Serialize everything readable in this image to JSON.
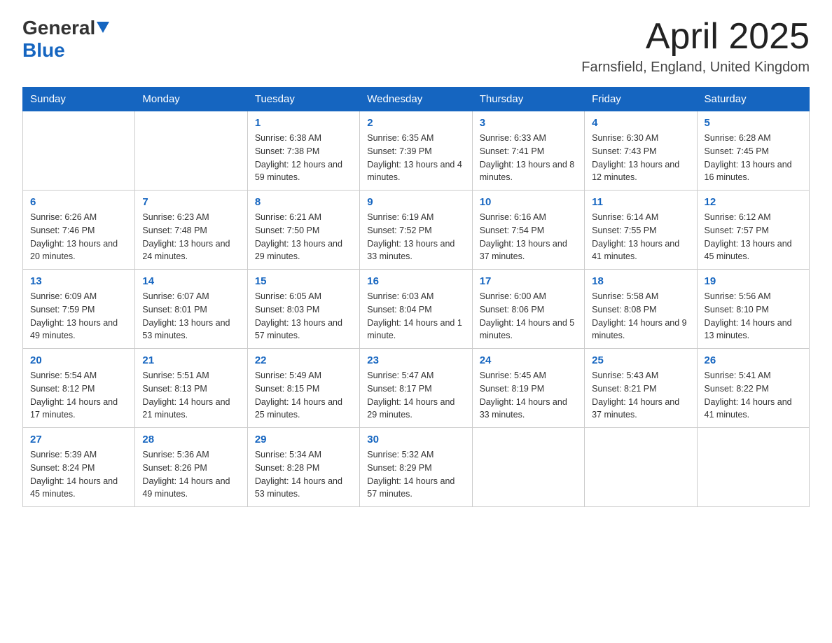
{
  "logo": {
    "general": "General",
    "blue": "Blue",
    "arrow": "▼"
  },
  "header": {
    "title": "April 2025",
    "location": "Farnsfield, England, United Kingdom"
  },
  "columns": [
    "Sunday",
    "Monday",
    "Tuesday",
    "Wednesday",
    "Thursday",
    "Friday",
    "Saturday"
  ],
  "weeks": [
    [
      {
        "day": "",
        "sunrise": "",
        "sunset": "",
        "daylight": ""
      },
      {
        "day": "",
        "sunrise": "",
        "sunset": "",
        "daylight": ""
      },
      {
        "day": "1",
        "sunrise": "Sunrise: 6:38 AM",
        "sunset": "Sunset: 7:38 PM",
        "daylight": "Daylight: 12 hours and 59 minutes."
      },
      {
        "day": "2",
        "sunrise": "Sunrise: 6:35 AM",
        "sunset": "Sunset: 7:39 PM",
        "daylight": "Daylight: 13 hours and 4 minutes."
      },
      {
        "day": "3",
        "sunrise": "Sunrise: 6:33 AM",
        "sunset": "Sunset: 7:41 PM",
        "daylight": "Daylight: 13 hours and 8 minutes."
      },
      {
        "day": "4",
        "sunrise": "Sunrise: 6:30 AM",
        "sunset": "Sunset: 7:43 PM",
        "daylight": "Daylight: 13 hours and 12 minutes."
      },
      {
        "day": "5",
        "sunrise": "Sunrise: 6:28 AM",
        "sunset": "Sunset: 7:45 PM",
        "daylight": "Daylight: 13 hours and 16 minutes."
      }
    ],
    [
      {
        "day": "6",
        "sunrise": "Sunrise: 6:26 AM",
        "sunset": "Sunset: 7:46 PM",
        "daylight": "Daylight: 13 hours and 20 minutes."
      },
      {
        "day": "7",
        "sunrise": "Sunrise: 6:23 AM",
        "sunset": "Sunset: 7:48 PM",
        "daylight": "Daylight: 13 hours and 24 minutes."
      },
      {
        "day": "8",
        "sunrise": "Sunrise: 6:21 AM",
        "sunset": "Sunset: 7:50 PM",
        "daylight": "Daylight: 13 hours and 29 minutes."
      },
      {
        "day": "9",
        "sunrise": "Sunrise: 6:19 AM",
        "sunset": "Sunset: 7:52 PM",
        "daylight": "Daylight: 13 hours and 33 minutes."
      },
      {
        "day": "10",
        "sunrise": "Sunrise: 6:16 AM",
        "sunset": "Sunset: 7:54 PM",
        "daylight": "Daylight: 13 hours and 37 minutes."
      },
      {
        "day": "11",
        "sunrise": "Sunrise: 6:14 AM",
        "sunset": "Sunset: 7:55 PM",
        "daylight": "Daylight: 13 hours and 41 minutes."
      },
      {
        "day": "12",
        "sunrise": "Sunrise: 6:12 AM",
        "sunset": "Sunset: 7:57 PM",
        "daylight": "Daylight: 13 hours and 45 minutes."
      }
    ],
    [
      {
        "day": "13",
        "sunrise": "Sunrise: 6:09 AM",
        "sunset": "Sunset: 7:59 PM",
        "daylight": "Daylight: 13 hours and 49 minutes."
      },
      {
        "day": "14",
        "sunrise": "Sunrise: 6:07 AM",
        "sunset": "Sunset: 8:01 PM",
        "daylight": "Daylight: 13 hours and 53 minutes."
      },
      {
        "day": "15",
        "sunrise": "Sunrise: 6:05 AM",
        "sunset": "Sunset: 8:03 PM",
        "daylight": "Daylight: 13 hours and 57 minutes."
      },
      {
        "day": "16",
        "sunrise": "Sunrise: 6:03 AM",
        "sunset": "Sunset: 8:04 PM",
        "daylight": "Daylight: 14 hours and 1 minute."
      },
      {
        "day": "17",
        "sunrise": "Sunrise: 6:00 AM",
        "sunset": "Sunset: 8:06 PM",
        "daylight": "Daylight: 14 hours and 5 minutes."
      },
      {
        "day": "18",
        "sunrise": "Sunrise: 5:58 AM",
        "sunset": "Sunset: 8:08 PM",
        "daylight": "Daylight: 14 hours and 9 minutes."
      },
      {
        "day": "19",
        "sunrise": "Sunrise: 5:56 AM",
        "sunset": "Sunset: 8:10 PM",
        "daylight": "Daylight: 14 hours and 13 minutes."
      }
    ],
    [
      {
        "day": "20",
        "sunrise": "Sunrise: 5:54 AM",
        "sunset": "Sunset: 8:12 PM",
        "daylight": "Daylight: 14 hours and 17 minutes."
      },
      {
        "day": "21",
        "sunrise": "Sunrise: 5:51 AM",
        "sunset": "Sunset: 8:13 PM",
        "daylight": "Daylight: 14 hours and 21 minutes."
      },
      {
        "day": "22",
        "sunrise": "Sunrise: 5:49 AM",
        "sunset": "Sunset: 8:15 PM",
        "daylight": "Daylight: 14 hours and 25 minutes."
      },
      {
        "day": "23",
        "sunrise": "Sunrise: 5:47 AM",
        "sunset": "Sunset: 8:17 PM",
        "daylight": "Daylight: 14 hours and 29 minutes."
      },
      {
        "day": "24",
        "sunrise": "Sunrise: 5:45 AM",
        "sunset": "Sunset: 8:19 PM",
        "daylight": "Daylight: 14 hours and 33 minutes."
      },
      {
        "day": "25",
        "sunrise": "Sunrise: 5:43 AM",
        "sunset": "Sunset: 8:21 PM",
        "daylight": "Daylight: 14 hours and 37 minutes."
      },
      {
        "day": "26",
        "sunrise": "Sunrise: 5:41 AM",
        "sunset": "Sunset: 8:22 PM",
        "daylight": "Daylight: 14 hours and 41 minutes."
      }
    ],
    [
      {
        "day": "27",
        "sunrise": "Sunrise: 5:39 AM",
        "sunset": "Sunset: 8:24 PM",
        "daylight": "Daylight: 14 hours and 45 minutes."
      },
      {
        "day": "28",
        "sunrise": "Sunrise: 5:36 AM",
        "sunset": "Sunset: 8:26 PM",
        "daylight": "Daylight: 14 hours and 49 minutes."
      },
      {
        "day": "29",
        "sunrise": "Sunrise: 5:34 AM",
        "sunset": "Sunset: 8:28 PM",
        "daylight": "Daylight: 14 hours and 53 minutes."
      },
      {
        "day": "30",
        "sunrise": "Sunrise: 5:32 AM",
        "sunset": "Sunset: 8:29 PM",
        "daylight": "Daylight: 14 hours and 57 minutes."
      },
      {
        "day": "",
        "sunrise": "",
        "sunset": "",
        "daylight": ""
      },
      {
        "day": "",
        "sunrise": "",
        "sunset": "",
        "daylight": ""
      },
      {
        "day": "",
        "sunrise": "",
        "sunset": "",
        "daylight": ""
      }
    ]
  ]
}
